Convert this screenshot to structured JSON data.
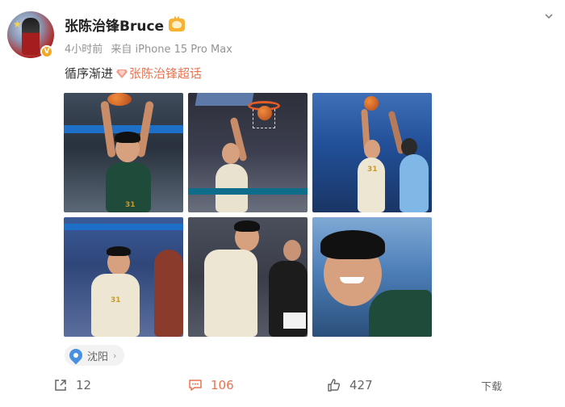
{
  "post": {
    "user_name": "张陈治锋Bruce",
    "time": "4小时前",
    "source": "来自 iPhone 15 Pro Max",
    "text": "循序渐进",
    "topic": "张陈治锋超话"
  },
  "images": [
    {
      "name": "photo-1",
      "jersey": "31"
    },
    {
      "name": "photo-2",
      "jersey": ""
    },
    {
      "name": "photo-3",
      "jersey": "31"
    },
    {
      "name": "photo-4",
      "jersey": "31"
    },
    {
      "name": "photo-5",
      "jersey": ""
    },
    {
      "name": "photo-6",
      "jersey": ""
    }
  ],
  "location": "沈阳",
  "actions": {
    "share_count": "12",
    "comment_count": "106",
    "like_count": "427",
    "download_label": "下载"
  },
  "colors": {
    "accent": "#eb7350",
    "muted": "#939393",
    "location_pin": "#4a90e2"
  },
  "icons": {
    "share": "share-icon",
    "comment": "comment-icon",
    "like": "thumbs-up-icon",
    "location": "location-pin-icon",
    "menu": "chevron-down-icon",
    "verified": "verified-badge-icon",
    "vip": "vip-crown-icon"
  }
}
